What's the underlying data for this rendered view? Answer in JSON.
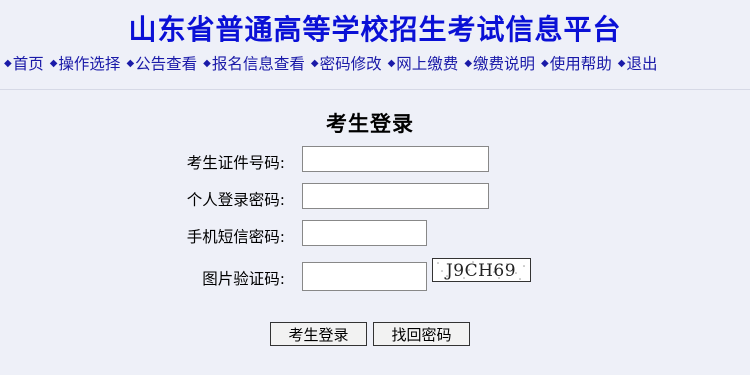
{
  "header": {
    "title": "山东省普通高等学校招生考试信息平台"
  },
  "nav": {
    "items": [
      "首页",
      "操作选择",
      "公告查看",
      "报名信息查看",
      "密码修改",
      "网上缴费",
      "缴费说明",
      "使用帮助",
      "退出"
    ]
  },
  "form": {
    "title": "考生登录",
    "id_label": "考生证件号码:",
    "password_label": "个人登录密码:",
    "sms_label": "手机短信密码:",
    "captcha_label": "图片验证码:",
    "captcha_text": "J9CH69"
  },
  "buttons": {
    "login": "考生登录",
    "recover": "找回密码"
  }
}
